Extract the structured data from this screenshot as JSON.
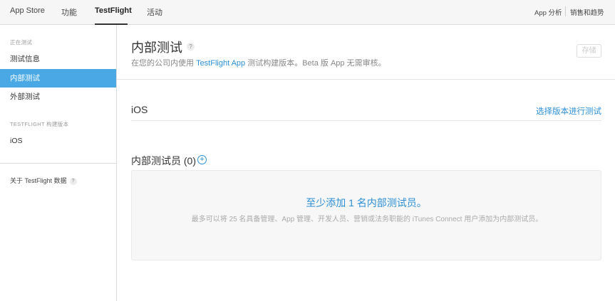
{
  "topnav": {
    "items": [
      {
        "label": "App Store"
      },
      {
        "label": "功能"
      },
      {
        "label": "TestFlight"
      },
      {
        "label": "活动"
      }
    ],
    "right": {
      "analytics": "App 分析",
      "sales": "销售和趋势"
    }
  },
  "sidebar": {
    "section_testing": "正在测试",
    "items": [
      {
        "label": "测试信息"
      },
      {
        "label": "内部测试"
      },
      {
        "label": "外部测试"
      }
    ],
    "section_builds": "TESTFLIGHT 构建版本",
    "builds": [
      {
        "label": "iOS"
      }
    ],
    "about": "关于 TestFlight 数据",
    "help_glyph": "?"
  },
  "main": {
    "title": "内部测试",
    "title_help": "?",
    "subtitle_prefix": "在您的公司内使用 ",
    "subtitle_link": "TestFlight App",
    "subtitle_suffix": " 测试构建版本。Beta 版 App 无需审核。",
    "save_label": "存储",
    "ios_heading": "iOS",
    "select_build_label": "选择版本进行测试",
    "testers_heading": "内部测试员 (0)",
    "add_glyph": "+",
    "empty_title": "至少添加 1 名内部测试员。",
    "empty_desc": "最多可以将 25 名具备管理、App 管理、开发人员、营销或法务职能的 iTunes Connect 用户添加为内部测试员。"
  },
  "colors": {
    "accent": "#2c8fd6",
    "sidebar_active": "#4aa9e5"
  }
}
